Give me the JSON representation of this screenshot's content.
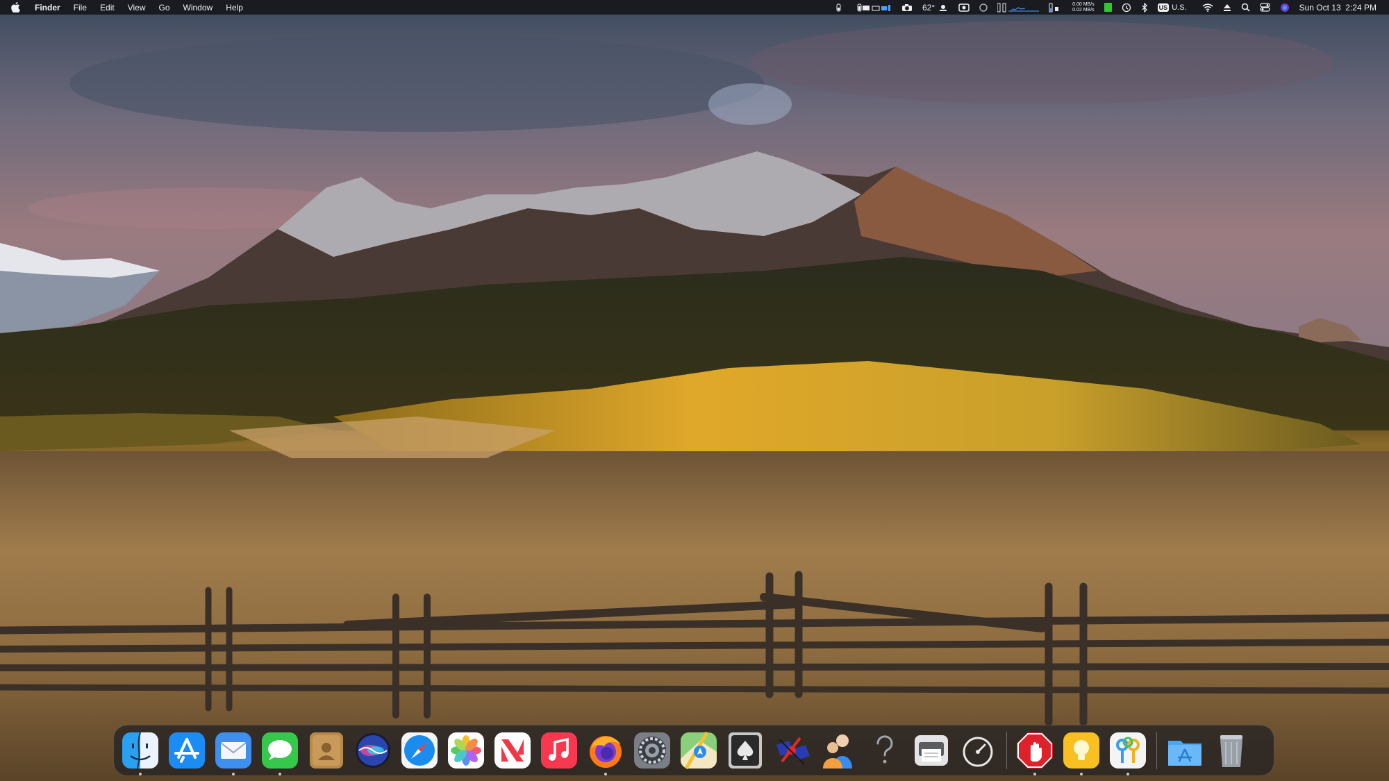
{
  "menubar": {
    "app_name": "Finder",
    "menus": [
      "File",
      "Edit",
      "View",
      "Go",
      "Window",
      "Help"
    ],
    "temperature": "62°",
    "net_up": "0.00 MB/s",
    "net_down": "0.02 MB/s",
    "input_source_badge": "US",
    "input_source_label": "U.S.",
    "datetime": "Sun Oct 13  2:24 PM"
  },
  "dock": {
    "apps": [
      {
        "name": "Finder",
        "icon": "finder-icon",
        "running": true
      },
      {
        "name": "App Store",
        "icon": "app-store-icon",
        "running": false
      },
      {
        "name": "Mail",
        "icon": "mail-icon",
        "running": true
      },
      {
        "name": "Messages",
        "icon": "messages-icon",
        "running": true
      },
      {
        "name": "Contacts",
        "icon": "contacts-icon",
        "running": false
      },
      {
        "name": "Siri",
        "icon": "siri-icon",
        "running": false
      },
      {
        "name": "Safari",
        "icon": "safari-icon",
        "running": false
      },
      {
        "name": "Photos",
        "icon": "photos-icon",
        "running": false
      },
      {
        "name": "News",
        "icon": "news-icon",
        "running": false
      },
      {
        "name": "Music",
        "icon": "music-icon",
        "running": false
      },
      {
        "name": "Firefox",
        "icon": "firefox-icon",
        "running": true
      },
      {
        "name": "System Preferences",
        "icon": "system-preferences-icon",
        "running": false
      },
      {
        "name": "Maps",
        "icon": "maps-icon",
        "running": false
      },
      {
        "name": "Solitaire",
        "icon": "solitaire-icon",
        "running": false
      },
      {
        "name": "Satellite Game",
        "icon": "satellite-icon",
        "running": false
      },
      {
        "name": "Users",
        "icon": "users-icon",
        "running": false
      },
      {
        "name": "Help",
        "icon": "help-icon",
        "running": false
      },
      {
        "name": "Printer",
        "icon": "printer-icon",
        "running": false
      },
      {
        "name": "Speedometer",
        "icon": "speedometer-icon",
        "running": false
      },
      {
        "name": "Stop",
        "icon": "stop-hand-icon",
        "running": true
      },
      {
        "name": "Tips",
        "icon": "tips-icon",
        "running": true
      },
      {
        "name": "Passwords",
        "icon": "keychain-icon",
        "running": true
      },
      {
        "name": "Applications Folder",
        "icon": "applications-folder-icon",
        "running": false
      },
      {
        "name": "Trash",
        "icon": "trash-icon",
        "running": false
      }
    ]
  }
}
